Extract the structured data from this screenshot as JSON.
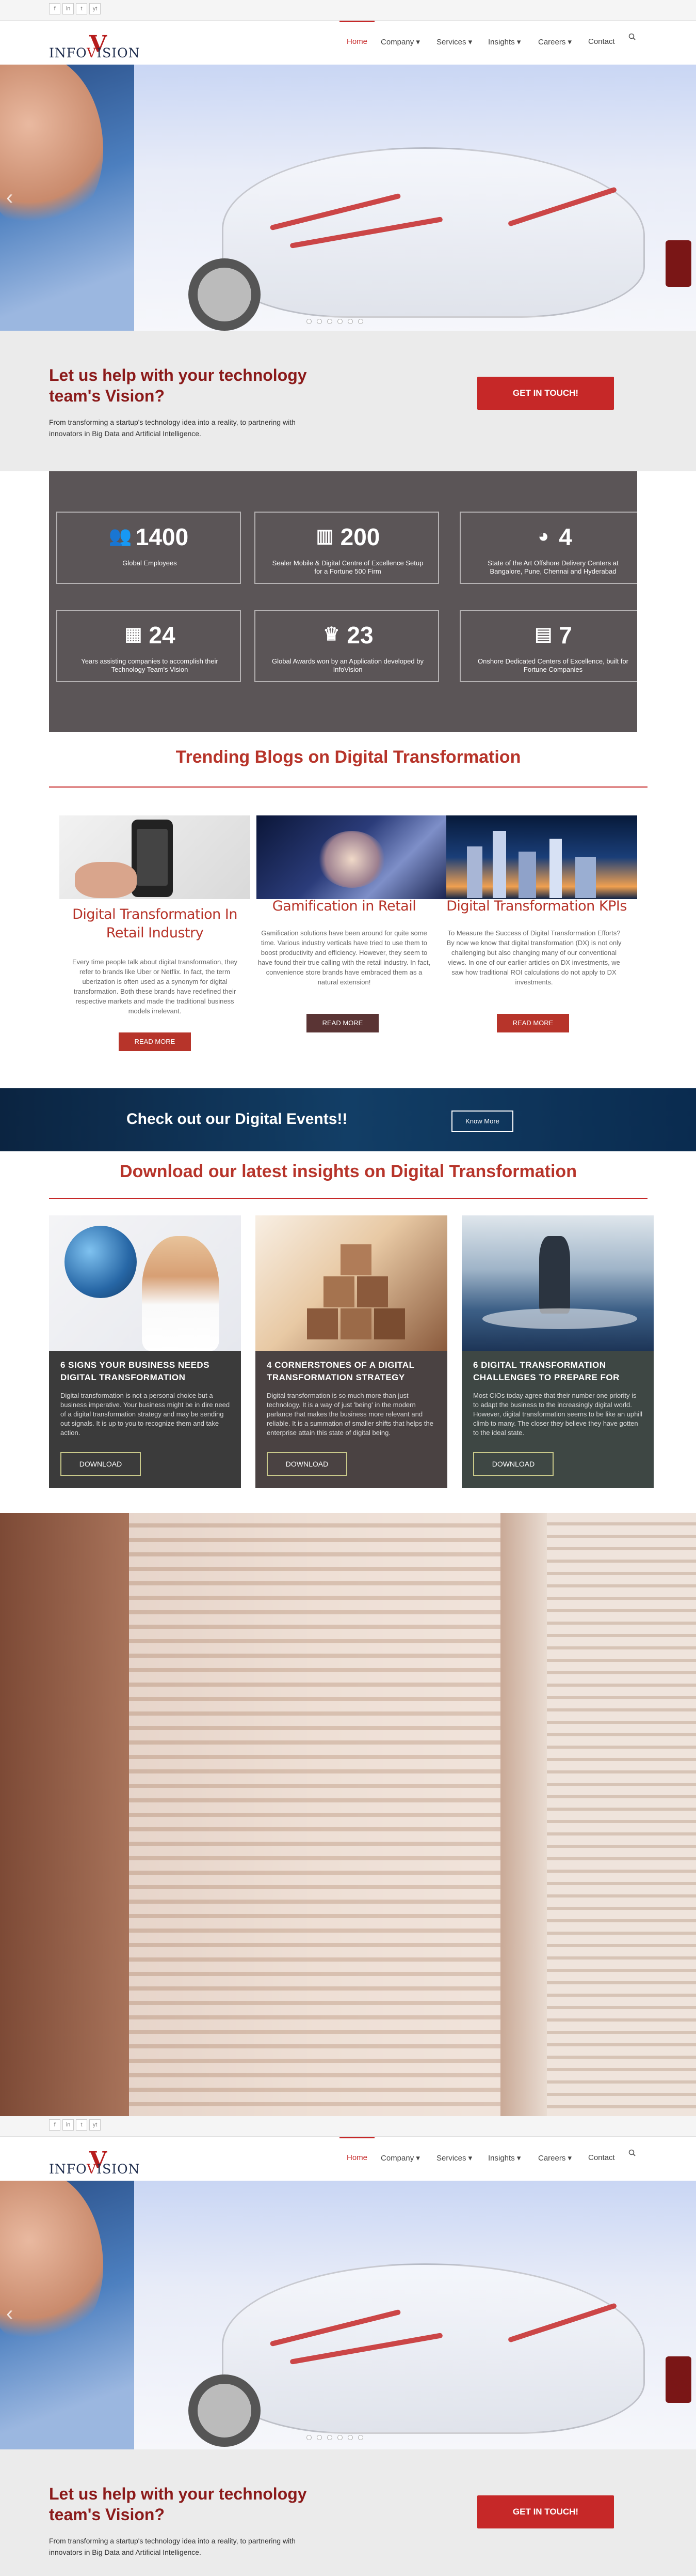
{
  "social": [
    "f",
    "in",
    "t",
    "yt"
  ],
  "brand": {
    "logo_prefix": "INFO",
    "logo_v": "V",
    "logo_suffix": "ISION"
  },
  "nav": {
    "items": [
      "Home",
      "Company ▾",
      "Services ▾",
      "Insights ▾",
      "Careers ▾",
      "Contact"
    ],
    "search_icon": "search-icon"
  },
  "hero": {
    "prev_arrow": "‹"
  },
  "cta": {
    "title": "Let us help with your technology team's Vision?",
    "subtitle": "From transforming a startup's technology idea into a reality, to partnering with innovators in Big Data and Artificial Intelligence.",
    "button": "GET IN TOUCH!"
  },
  "stats": [
    {
      "icon": "people-icon",
      "glyph": "👥",
      "value": "1400",
      "label": "Global Employees"
    },
    {
      "icon": "building-icon",
      "glyph": "▥",
      "value": "200",
      "label": "Sealer Mobile & Digital Centre of Excellence Setup for a Fortune 500 Firm"
    },
    {
      "icon": "globe-icon",
      "glyph": "◕",
      "value": "4",
      "label": "State of the Art Offshore Delivery Centers at Bangalore, Pune, Chennai and Hyderabad"
    },
    {
      "icon": "calendar-icon",
      "glyph": "▦",
      "value": "24",
      "label": "Years assisting companies to accomplish their Technology Team's Vision"
    },
    {
      "icon": "trophy-icon",
      "glyph": "♛",
      "value": "23",
      "label": "Global Awards won by an Application developed by InfoVision"
    },
    {
      "icon": "briefcase-icon",
      "glyph": "▤",
      "value": "7",
      "label": "Onshore Dedicated Centers of Excellence, built for Fortune Companies"
    }
  ],
  "blogs": {
    "heading": "Trending Blogs on Digital Transformation",
    "items": [
      {
        "title": "Digital Transformation In Retail Industry",
        "text": "Every time people talk about digital transformation, they refer to brands like Uber or Netflix. In fact, the term uberization is often used as a synonym for digital transformation. Both these brands have redefined their respective markets and made the traditional business models irrelevant.",
        "button": "READ MORE"
      },
      {
        "title": "Gamification in Retail",
        "text": "Gamification solutions have been around for quite some time. Various industry verticals have tried to use them to boost productivity and efficiency. However, they seem to have found their true calling with the retail industry. In fact, convenience store brands have embraced them as a natural extension!",
        "button": "READ MORE"
      },
      {
        "title": "Digital Transformation KPIs",
        "text": "To Measure the Success of Digital Transformation Efforts? By now we know that digital transformation (DX) is not only challenging but also changing many of our conventional views. In one of our earlier articles on DX investments, we saw how traditional ROI calculations do not apply to DX investments.",
        "button": "READ MORE"
      }
    ]
  },
  "events": {
    "title": "Check out our Digital Events!!",
    "button": "Know More"
  },
  "insights": {
    "heading": "Download our latest insights on Digital Transformation",
    "items": [
      {
        "title": "6 SIGNS YOUR BUSINESS NEEDS DIGITAL TRANSFORMATION",
        "text": "Digital transformation is not a personal choice but a business imperative. Your business might be in dire need of a digital transformation strategy and may be sending out signals. It is up to you to recognize them and take action.",
        "button": "DOWNLOAD"
      },
      {
        "title": "4 CORNERSTONES OF A DIGITAL TRANSFORMATION STRATEGY",
        "text": "Digital transformation is so much more than just technology. It is a way of just 'being' in the modern parlance that makes the business more relevant and reliable. It is a summation of smaller shifts that helps the enterprise attain this state of digital being.",
        "button": "DOWNLOAD"
      },
      {
        "title": "6 DIGITAL TRANSFORMATION CHALLENGES TO PREPARE FOR",
        "text": "Most CIOs today agree that their number one priority is to adapt the business to the increasingly digital world. However, digital transformation seems to be like an uphill climb to many. The closer they believe they have gotten to the ideal state.",
        "button": "DOWNLOAD"
      }
    ]
  }
}
